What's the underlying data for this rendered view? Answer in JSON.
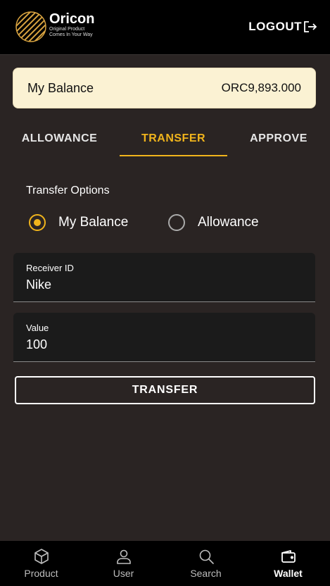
{
  "header": {
    "brand_name": "Oricon",
    "brand_tagline_1": "Original Product",
    "brand_tagline_2": "Comes In Your Way",
    "logout_label": "LOGOUT"
  },
  "balance": {
    "label": "My Balance",
    "value": "ORC9,893.000"
  },
  "tabs": [
    {
      "label": "ALLOWANCE",
      "active": false
    },
    {
      "label": "TRANSFER",
      "active": true
    },
    {
      "label": "APPROVE",
      "active": false
    }
  ],
  "transfer_options": {
    "label": "Transfer Options",
    "options": [
      {
        "label": "My Balance",
        "selected": true
      },
      {
        "label": "Allowance",
        "selected": false
      }
    ]
  },
  "fields": {
    "receiver": {
      "label": "Receiver ID",
      "value": "Nike"
    },
    "value": {
      "label": "Value",
      "value": "100"
    }
  },
  "transfer_button": "TRANSFER",
  "bottom_nav": [
    {
      "label": "Product",
      "icon": "box-icon",
      "active": false
    },
    {
      "label": "User",
      "icon": "user-icon",
      "active": false
    },
    {
      "label": "Search",
      "icon": "search-icon",
      "active": false
    },
    {
      "label": "Wallet",
      "icon": "wallet-icon",
      "active": true
    }
  ],
  "colors": {
    "accent": "#f0b41c",
    "background": "#2a2423",
    "header": "#000000",
    "balance_card": "#fbf2d3"
  }
}
